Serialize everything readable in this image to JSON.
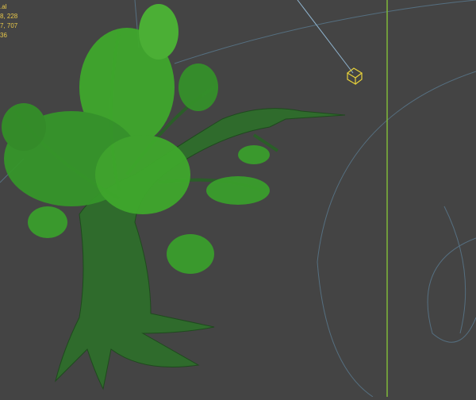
{
  "viewport": {
    "background": "#444444",
    "stats": [
      ".al",
      "8, 228",
      "7, 707",
      "",
      "36"
    ],
    "colors": {
      "text": "#e8c84a",
      "leaf": "#3fa82c",
      "trunk": "#2f6b2c",
      "light_line": "#8fb4cf",
      "guide_green": "#7fb83a",
      "helper": "#e8d23a"
    }
  }
}
